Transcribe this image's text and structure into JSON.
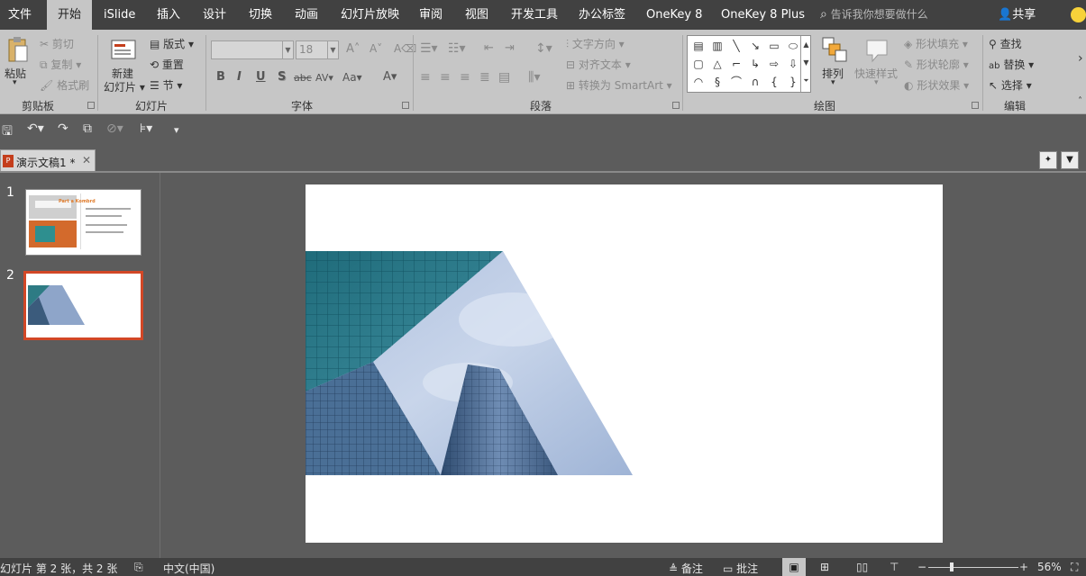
{
  "menu": {
    "tabs": [
      {
        "label": "文件"
      },
      {
        "label": "开始"
      },
      {
        "label": "iSlide"
      },
      {
        "label": "插入"
      },
      {
        "label": "设计"
      },
      {
        "label": "切换"
      },
      {
        "label": "动画"
      },
      {
        "label": "幻灯片放映"
      },
      {
        "label": "审阅"
      },
      {
        "label": "视图"
      },
      {
        "label": "开发工具"
      },
      {
        "label": "办公标签"
      },
      {
        "label": "OneKey 8"
      },
      {
        "label": "OneKey 8 Plus"
      }
    ],
    "tell_me": "告诉我你想要做什么",
    "share": "共享"
  },
  "ribbon": {
    "clipboard": {
      "paste": "粘贴",
      "cut": "剪切",
      "copy": "复制",
      "format_painter": "格式刷",
      "label": "剪贴板"
    },
    "slides": {
      "new_slide_1": "新建",
      "new_slide_2": "幻灯片",
      "layout": "版式",
      "reset": "重置",
      "section": "节",
      "label": "幻灯片"
    },
    "font": {
      "size": "18",
      "bold": "B",
      "italic": "I",
      "underline": "U",
      "shadow": "S",
      "strike": "abc",
      "spacing": "AV",
      "case": "Aa",
      "color": "A",
      "label": "字体"
    },
    "paragraph": {
      "text_direction": "文字方向",
      "align_text": "对齐文本",
      "smartart": "转换为 SmartArt",
      "label": "段落"
    },
    "drawing": {
      "arrange": "排列",
      "quick_styles": "快速样式",
      "fill": "形状填充",
      "outline": "形状轮廓",
      "effects": "形状效果",
      "label": "绘图"
    },
    "editing": {
      "find": "查找",
      "replace": "替换",
      "select": "选择",
      "label": "编辑"
    }
  },
  "document": {
    "tab_name": "演示文稿1 *"
  },
  "slides_pane": {
    "numbers": [
      "1",
      "2"
    ],
    "thumb1": {
      "title": "Part a Kombrd"
    }
  },
  "status": {
    "slide_info": "幻灯片 第 2 张，共 2 张",
    "language": "中文(中国)",
    "notes": "备注",
    "comments": "批注",
    "zoom": "56%",
    "zoom_level": 0.56
  },
  "colors": {
    "selection": "#d24726",
    "accent": "#c43e1c"
  }
}
